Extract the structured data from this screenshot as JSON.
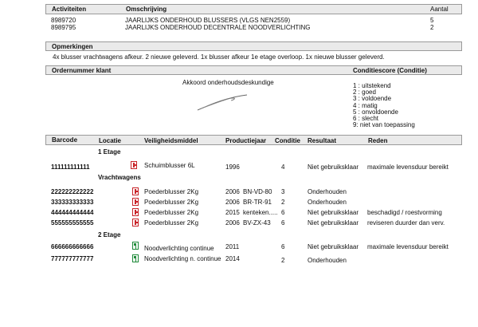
{
  "activities": {
    "col_activity": "Activiteiten",
    "col_description": "Omschrijving",
    "col_count": "Aantal",
    "rows": [
      {
        "code": "8989720",
        "description": "JAARLIJKS ONDERHOUD BLUSSERS (VLGS NEN2559)",
        "count": "5"
      },
      {
        "code": "8989795",
        "description": "JAARLIJKS ONDERHOUD DECENTRALE NOODVERLICHTING",
        "count": "2"
      }
    ]
  },
  "remarks": {
    "title": "Opmerkingen",
    "text": "4x blusser vrachtwagens afkeur. 2 nieuwe geleverd. 1x blusser afkeur 1e etage overloop. 1x nieuwe blusser geleverd."
  },
  "order": {
    "title": "Ordernummer klant",
    "approval_label": "Akkoord onderhoudsdeskundige",
    "condition_title": "Conditiescore (Conditie)",
    "condition_scale": [
      "1 : uitstekend",
      "2 : goed",
      "3 : voldoende",
      "4 : matig",
      "5 : onvoldoende",
      "6 : slecht",
      "9: niet van toepassing"
    ]
  },
  "items": {
    "headers": {
      "barcode": "Barcode",
      "location": "Locatie",
      "safety": "Veiligheidsmiddel",
      "year": "Productiejaar",
      "condition": "Conditie",
      "result": "Resultaat",
      "reason": "Reden"
    },
    "groups": [
      {
        "label": "1 Etage"
      },
      {
        "label": "Vrachtwagens"
      },
      {
        "label": "2 Etage"
      }
    ],
    "rows": [
      {
        "barcode": "111111111111",
        "icon": "fire-extinguisher-icon",
        "safety": "Schuimblusser 6L",
        "year": "1996",
        "plate": "",
        "condition": "4",
        "result": "Niet gebruiksklaar",
        "reason": "maximale levensduur bereikt"
      },
      {
        "barcode": "222222222222",
        "icon": "fire-extinguisher-icon",
        "safety": "Poederblusser 2Kg",
        "year": "2006",
        "plate": "BN-VD-80",
        "condition": "3",
        "result": "Onderhouden",
        "reason": ""
      },
      {
        "barcode": "333333333333",
        "icon": "fire-extinguisher-icon",
        "safety": "Poederblusser 2Kg",
        "year": "2006",
        "plate": "BR-TR-91",
        "condition": "2",
        "result": "Onderhouden",
        "reason": ""
      },
      {
        "barcode": "444444444444",
        "icon": "fire-extinguisher-icon",
        "safety": "Poederblusser 2Kg",
        "year": "2015",
        "plate": "kenteken.....",
        "condition": "6",
        "result": "Niet gebruiksklaar",
        "reason": "beschadigd / roestvorming"
      },
      {
        "barcode": "555555555555",
        "icon": "fire-extinguisher-icon",
        "safety": "Poederblusser 2Kg",
        "year": "2006",
        "plate": "BV-ZX-43",
        "condition": "6",
        "result": "Niet gebruiksklaar",
        "reason": "reviseren duurder dan verv."
      },
      {
        "barcode": "666666666666",
        "icon": "emergency-light-icon",
        "safety": "Noodverlichting continue",
        "year": "2011",
        "plate": "",
        "condition": "6",
        "result": "Niet gebruiksklaar",
        "reason": "maximale levensduur bereikt"
      },
      {
        "barcode": "777777777777",
        "icon": "emergency-light-icon",
        "safety": "Noodverlichting n. continue",
        "year": "2014",
        "plate": "",
        "condition": "2",
        "result": "Onderhouden",
        "reason": ""
      }
    ]
  }
}
